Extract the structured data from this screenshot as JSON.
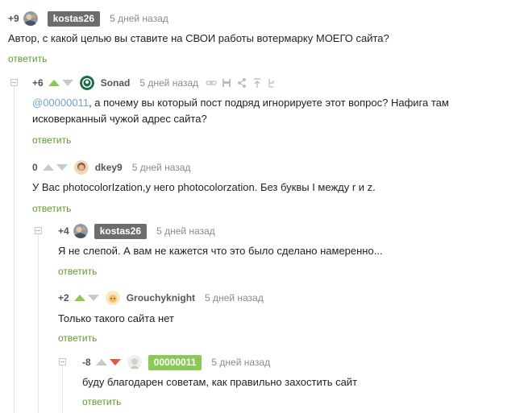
{
  "comments": [
    {
      "rating": "+9",
      "author": "kostas26",
      "time": "5 дней назад",
      "text": "Автор, с какой целью вы ставите на СВОИ работы вотермарку МОЕГО сайта?",
      "reply": "ответить"
    },
    {
      "rating": "+6",
      "author": "Sonad",
      "time": "5 дней назад",
      "mention": "@00000011",
      "text_line1": ", а почему вы который пост подряд игнорируете этот вопрос? Нафига там",
      "text_line2": "исковерканный чужой адрес сайта?",
      "reply": "ответить",
      "tools": [
        "link-icon",
        "save-icon",
        "share-icon",
        "scroll-top-icon",
        "tree-icon"
      ]
    },
    {
      "rating": "0",
      "author": "dkey9",
      "time": "5 дней назад",
      "text": "У Вас photocolorIzation,у него photocolorzation. Без буквы I между r и z.",
      "reply": "ответить"
    },
    {
      "rating": "+4",
      "author": "kostas26",
      "time": "5 дней назад",
      "text": "Я не слепой. А вам не кажется что это было сделано намеренно...",
      "reply": "ответить"
    },
    {
      "rating": "+2",
      "author": "Grouchyknight",
      "time": "5 дней назад",
      "text": "Только такого сайта нет",
      "reply": "ответить"
    },
    {
      "rating": "-8",
      "author": "00000011",
      "time": "5 дней назад",
      "text": "буду благодарен советам, как правильно захостить сайт",
      "reply": "ответить"
    }
  ],
  "colors": {
    "upvote": "#8ac858",
    "downvote_active": "#e4584c",
    "inactive_arrow": "#c9c9c9",
    "reply_link": "#5e9b2d",
    "mention": "#6ea4cd",
    "badge_grey": "#6d6d6d",
    "badge_green": "#8ac858"
  }
}
